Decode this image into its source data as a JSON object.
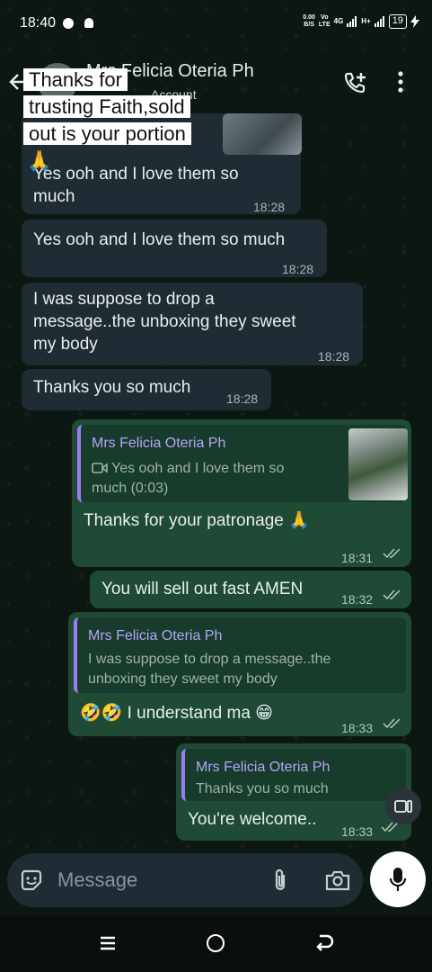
{
  "status_bar": {
    "time": "18:40",
    "net_speed_value": "0.00",
    "net_speed_unit": "B/S",
    "volte_top": "Vo",
    "volte_bottom": "LTE",
    "network": "4G",
    "network2": "H+",
    "battery": "19"
  },
  "header": {
    "name": "Mrs Felicia Oteria Ph",
    "subtitle": "Account"
  },
  "sticker": {
    "lines": [
      "Thanks for",
      "trusting Faith,sold",
      "out is your portion",
      "🙏"
    ]
  },
  "messages": [
    {
      "text_line1": "Yes ooh and I love them so",
      "text_line2": "much",
      "time": "18:28"
    },
    {
      "text": "Yes ooh and I love them so much",
      "time": "18:28"
    },
    {
      "text_line1": "I was suppose to drop a",
      "text_line2": "message..the unboxing they sweet",
      "text_line3": "my body",
      "time": "18:28"
    },
    {
      "text": "Thanks you so much",
      "time": "18:28"
    },
    {
      "quote_name": "Mrs Felicia Oteria Ph",
      "quote_line1": "Yes ooh and I love them so",
      "quote_line2": "much (0:03)",
      "text": "Thanks for your patronage 🙏",
      "time": "18:31"
    },
    {
      "text": "You will sell out fast AMEN",
      "time": "18:32"
    },
    {
      "quote_name": "Mrs Felicia Oteria Ph",
      "quote_line1": "I was suppose to drop a message..the",
      "quote_line2": "unboxing they sweet my body",
      "text": "🤣🤣 I understand ma 😁",
      "time": "18:33"
    },
    {
      "quote_name": "Mrs Felicia Oteria Ph",
      "quote_line1": "Thanks you so much",
      "text": "You're welcome..",
      "time": "18:33"
    }
  ],
  "input": {
    "placeholder": "Message"
  },
  "icons": [
    "back-arrow",
    "add-call",
    "more-vertical",
    "video",
    "double-check",
    "emoji",
    "attach",
    "camera",
    "mic",
    "recents",
    "home",
    "back"
  ],
  "colors": {
    "incoming": "#1f2c33",
    "outgoing": "#1e4a36",
    "quote_accent": "#9b7cf0"
  }
}
